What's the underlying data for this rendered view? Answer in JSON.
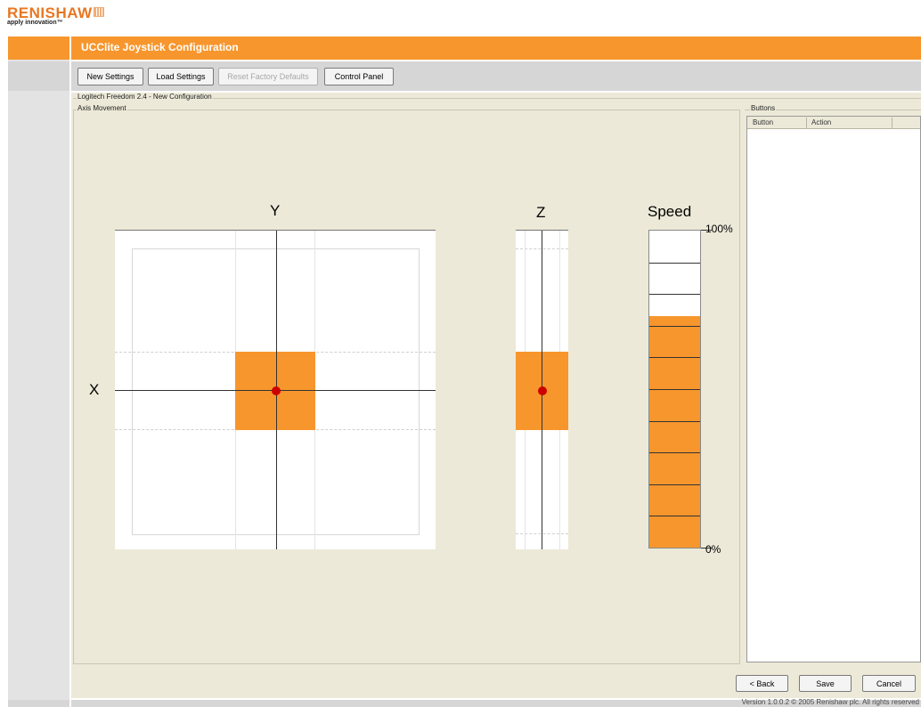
{
  "logo": {
    "brand": "RENISHAW",
    "tagline": "apply innovation™"
  },
  "title": "UCClite Joystick Configuration",
  "toolbar": {
    "new_settings": "New Settings",
    "load_settings": "Load Settings",
    "reset_factory_defaults": "Reset Factory Defaults",
    "control_panel": "Control Panel"
  },
  "config_group_label": "Logitech Freedom 2.4 - New Configuration",
  "axis_group_label": "Axis Movement",
  "axes": {
    "y_label": "Y",
    "x_label": "X",
    "z_label": "Z"
  },
  "speed": {
    "label": "Speed",
    "max_label": "100%",
    "min_label": "0%",
    "level_fraction": 0.73
  },
  "buttons_panel": {
    "label": "Buttons",
    "columns": [
      "Button",
      "Action"
    ]
  },
  "footer_buttons": {
    "back": "< Back",
    "save": "Save",
    "cancel": "Cancel"
  },
  "version_text": "Version 1.0.0.2 © 2005 Renishaw plc. All rights reserved",
  "colors": {
    "accent": "#f7962d",
    "indicator": "#cc0000"
  }
}
